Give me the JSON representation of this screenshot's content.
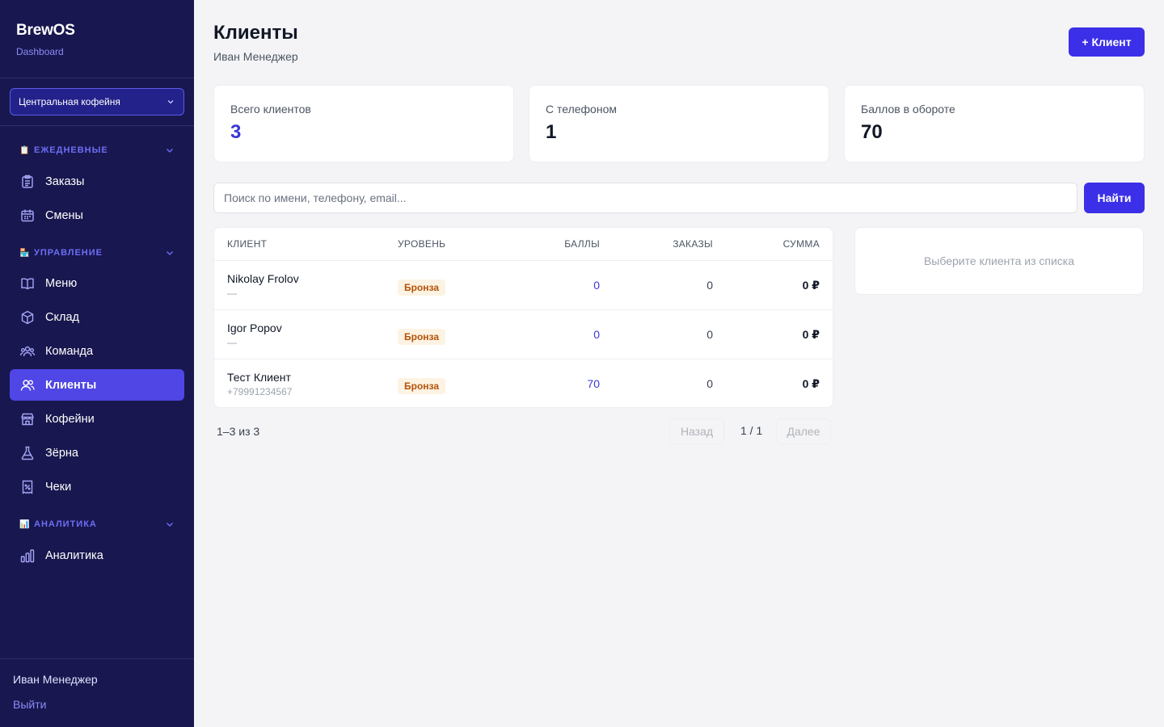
{
  "sidebar": {
    "brand": "BrewOS",
    "brand_sub": "Dashboard",
    "store_select": "Центральная кофейня",
    "sections": {
      "daily": {
        "emoji": "📋",
        "label": "ЕЖЕДНЕВНЫЕ"
      },
      "manage": {
        "emoji": "🏪",
        "label": "УПРАВЛЕНИЕ"
      },
      "analytics": {
        "emoji": "📊",
        "label": "АНАЛИТИКА"
      }
    },
    "items": {
      "orders": "Заказы",
      "shifts": "Смены",
      "menu": "Меню",
      "warehouse": "Склад",
      "team": "Команда",
      "clients": "Клиенты",
      "cafes": "Кофейни",
      "beans": "Зёрна",
      "receipts": "Чеки",
      "analytics": "Аналитика"
    },
    "user": "Иван Менеджер",
    "logout": "Выйти",
    "colors": {
      "bg": "#18174f",
      "active": "#4f46e5",
      "accent": "#6d6ef5"
    }
  },
  "header": {
    "title": "Клиенты",
    "subtitle": "Иван Менеджер",
    "add_button": "+ Клиент"
  },
  "stats": [
    {
      "label": "Всего клиентов",
      "value": "3"
    },
    {
      "label": "С телефоном",
      "value": "1"
    },
    {
      "label": "Баллов в обороте",
      "value": "70"
    }
  ],
  "search": {
    "placeholder": "Поиск по имени, телефону, email...",
    "button": "Найти"
  },
  "table": {
    "headers": {
      "client": "КЛИЕНТ",
      "level": "УРОВЕНЬ",
      "points": "БАЛЛЫ",
      "orders": "ЗАКАЗЫ",
      "sum": "СУММА"
    },
    "rows": [
      {
        "name": "Nikolay Frolov",
        "sub": "—",
        "level": "Бронза",
        "points": "0",
        "orders": "0",
        "sum": "0 ₽"
      },
      {
        "name": "Igor Popov",
        "sub": "—",
        "level": "Бронза",
        "points": "0",
        "orders": "0",
        "sum": "0 ₽"
      },
      {
        "name": "Тест Клиент",
        "sub": "+79991234567",
        "level": "Бронза",
        "points": "70",
        "orders": "0",
        "sum": "0 ₽"
      }
    ]
  },
  "pagination": {
    "info": "1–3 из 3",
    "prev": "Назад",
    "page": "1 / 1",
    "next": "Далее"
  },
  "detail": {
    "empty": "Выберите клиента из списка"
  },
  "colors": {
    "primary": "#3b2fe8",
    "badge_bg": "#fdf3e3",
    "badge_text": "#b45309"
  }
}
